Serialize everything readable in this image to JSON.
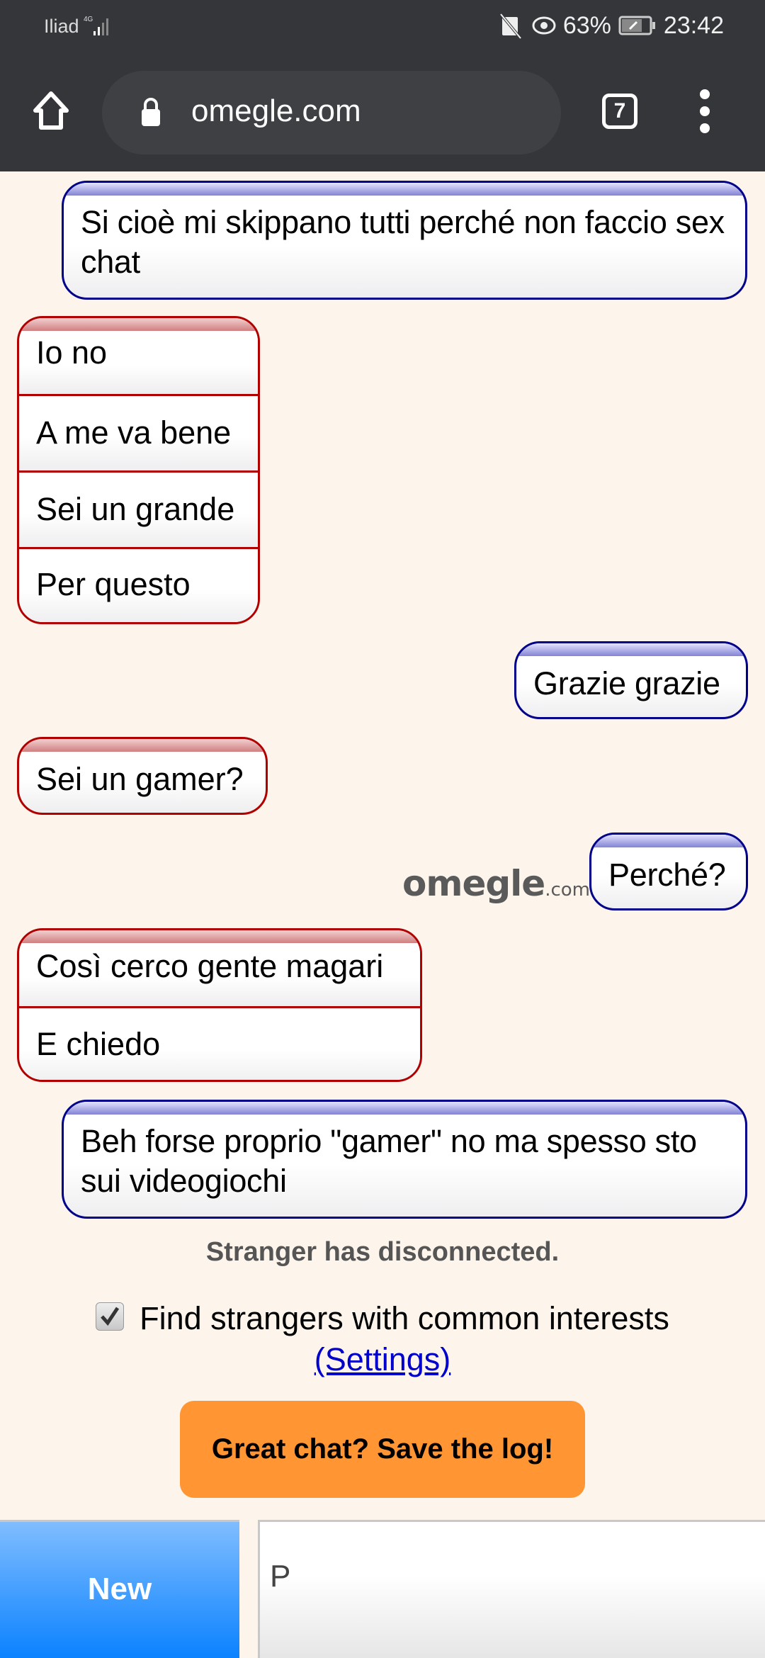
{
  "status_bar": {
    "carrier": "Iliad",
    "network": "4G",
    "battery_percent": "63%",
    "time": "23:42",
    "icons": [
      "nfc-off-icon",
      "eye-icon",
      "battery-saver-icon"
    ]
  },
  "browser": {
    "url": "omegle.com",
    "tab_count": "7",
    "icons": [
      "home-icon",
      "lock-icon",
      "tab-switcher-icon",
      "more-menu-icon"
    ]
  },
  "chat": {
    "messages": [
      {
        "from": "you",
        "lines": [
          "Si cioè mi skippano tutti perché non faccio sex chat"
        ]
      },
      {
        "from": "stranger",
        "lines": [
          "Io no",
          "A me va bene",
          "Sei un grande",
          "Per questo"
        ]
      },
      {
        "from": "you",
        "lines": [
          "Grazie grazie"
        ]
      },
      {
        "from": "stranger",
        "lines": [
          "Sei un gamer?"
        ]
      },
      {
        "from": "you",
        "lines": [
          "Perché?"
        ]
      },
      {
        "from": "stranger",
        "lines": [
          "Così cerco gente magari",
          "E chiedo"
        ]
      },
      {
        "from": "you",
        "lines": [
          "Beh forse proprio \"gamer\" no ma spesso sto sui videogiochi"
        ]
      }
    ],
    "watermark": {
      "brand": "omegle",
      "suffix": ".com"
    },
    "status_text": "Stranger has disconnected."
  },
  "options": {
    "common_interests_label": "Find strangers with common interests",
    "common_interests_checked": true,
    "settings_link": "(Settings)"
  },
  "actions": {
    "save_log_label": "Great chat? Save the log!",
    "new_label": "New",
    "input_value": "P"
  },
  "colors": {
    "you_border": "#00008b",
    "stranger_border": "#b00000",
    "save_button": "#ff9533",
    "new_button": "#0b82ff",
    "background": "#fdf5ec"
  }
}
